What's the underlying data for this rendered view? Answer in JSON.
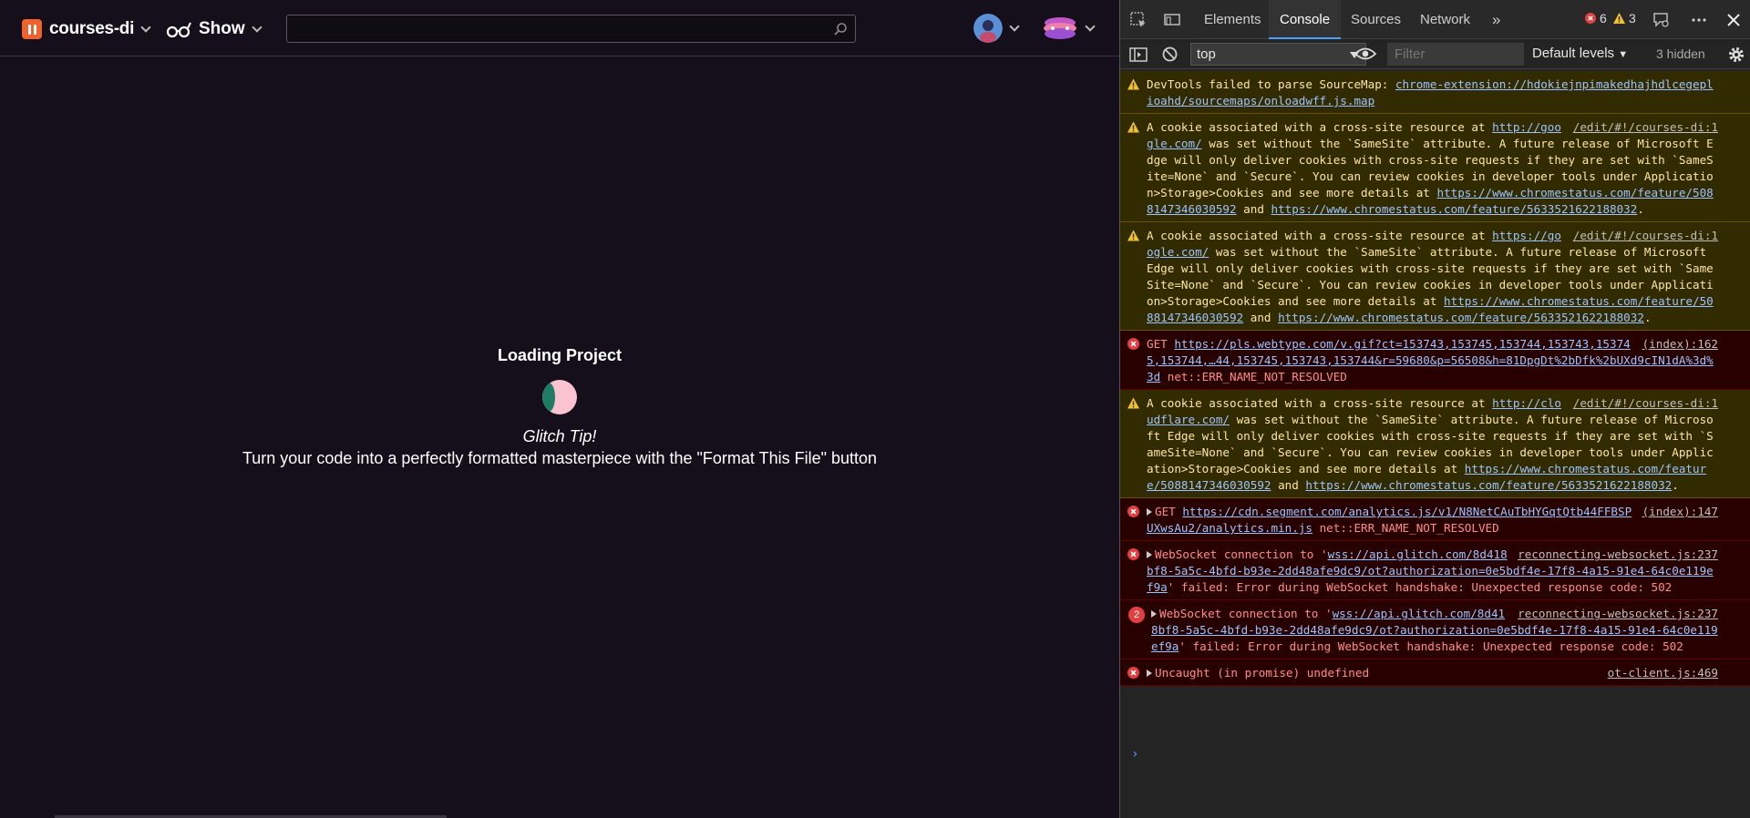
{
  "app": {
    "project_name": "courses-di",
    "show_label": "Show",
    "search": {
      "value": "",
      "placeholder": ""
    },
    "loading": {
      "title": "Loading Project",
      "tip_heading": "Glitch Tip!",
      "tip_body": "Turn your code into a perfectly formatted masterpiece with the \"Format This File\" button"
    }
  },
  "devtools": {
    "tabs": [
      "Elements",
      "Console",
      "Sources",
      "Network"
    ],
    "active_tab": "Console",
    "more_tabs": "»",
    "error_count": "6",
    "warning_count": "3",
    "context": "top",
    "filter_placeholder": "Filter",
    "levels_label": "Default levels",
    "hidden_label": "3 hidden",
    "prompt": "›",
    "messages": [
      {
        "level": "warning",
        "text": "DevTools failed to parse SourceMap: ",
        "link": "chrome-extension://hdokiejnpimakedhajhdlcegeplioahd/sourcemaps/onloadwff.js.map"
      },
      {
        "level": "warning",
        "source": "/edit/#!/courses-di:1",
        "pre": "A cookie associated with a cross-site resource at ",
        "link1": "http://google.com/",
        "mid": " was set without the `SameSite` attribute. A future release of Microsoft Edge will only deliver cookies with cross-site requests if they are set with `SameSite=None` and `Secure`. You can review cookies in developer tools under Application>Storage>Cookies and see more details at ",
        "link2": "https://www.chromestatus.com/feature/5088147346030592",
        "and": " and ",
        "link3": "https://www.chromestatus.com/feature/5633521622188032",
        "end": "."
      },
      {
        "level": "warning",
        "source": "/edit/#!/courses-di:1",
        "pre": "A cookie associated with a cross-site resource at ",
        "link1": "https://google.com/",
        "mid": " was set without the `SameSite` attribute. A future release of Microsoft Edge will only deliver cookies with cross-site requests if they are set with `SameSite=None` and `Secure`. You can review cookies in developer tools under Application>Storage>Cookies and see more details at ",
        "link2": "https://www.chromestatus.com/feature/5088147346030592",
        "and": " and ",
        "link3": "https://www.chromestatus.com/feature/5633521622188032",
        "end": "."
      },
      {
        "level": "error",
        "source": "(index):162",
        "pre": "GET ",
        "link1": "https://pls.webtype.com/v.gif?ct=153743,153745,153744,153743,153745,153744,…44,153745,153743,153744&r=59680&p=56508&h=81DpgDt%2bDfk%2bUXd9cIN1dA%3d%3d",
        "end": " net::ERR_NAME_NOT_RESOLVED"
      },
      {
        "level": "warning",
        "source": "/edit/#!/courses-di:1",
        "pre": "A cookie associated with a cross-site resource at ",
        "link1": "http://cloudflare.com/",
        "mid": " was set without the `SameSite` attribute. A future release of Microsoft Edge will only deliver cookies with cross-site requests if they are set with `SameSite=None` and `Secure`. You can review cookies in developer tools under Application>Storage>Cookies and see more details at ",
        "link2": "https://www.chromestatus.com/feature/5088147346030592",
        "and": " and ",
        "link3": "https://www.chromestatus.com/feature/5633521622188032",
        "end": "."
      },
      {
        "level": "error",
        "source": "(index):147",
        "pre": "GET ",
        "link1": "https://cdn.segment.com/analytics.js/v1/N8NetCAuTbHYGqtQtb44FFBSPUXwsAu2/analytics.min.js",
        "end": " net::ERR_NAME_NOT_RESOLVED"
      },
      {
        "level": "error",
        "source": "reconnecting-websocket.js:237",
        "pre": "WebSocket connection to '",
        "link1": "wss://api.glitch.com/8d418bf8-5a5c-4bfd-b93e-2dd48afe9dc9/ot?authorization=0e5bdf4e-17f8-4a15-91e4-64c0e119ef9a",
        "end": "' failed: Error during WebSocket handshake: Unexpected response code: 502"
      },
      {
        "level": "error",
        "count": "2",
        "source": "reconnecting-websocket.js:237",
        "pre": "WebSocket connection to '",
        "link1": "wss://api.glitch.com/8d418bf8-5a5c-4bfd-b93e-2dd48afe9dc9/ot?authorization=0e5bdf4e-17f8-4a15-91e4-64c0e119ef9a",
        "end": "' failed: Error during WebSocket handshake: Unexpected response code: 502"
      },
      {
        "level": "error",
        "source": "ot-client.js:469",
        "pre": "Uncaught (in promise) undefined"
      }
    ]
  },
  "colors": {
    "accent": "#f0622d",
    "active_tab_border": "#4aa3ff",
    "error_bg": "#290000",
    "warning_bg": "#332b00"
  }
}
